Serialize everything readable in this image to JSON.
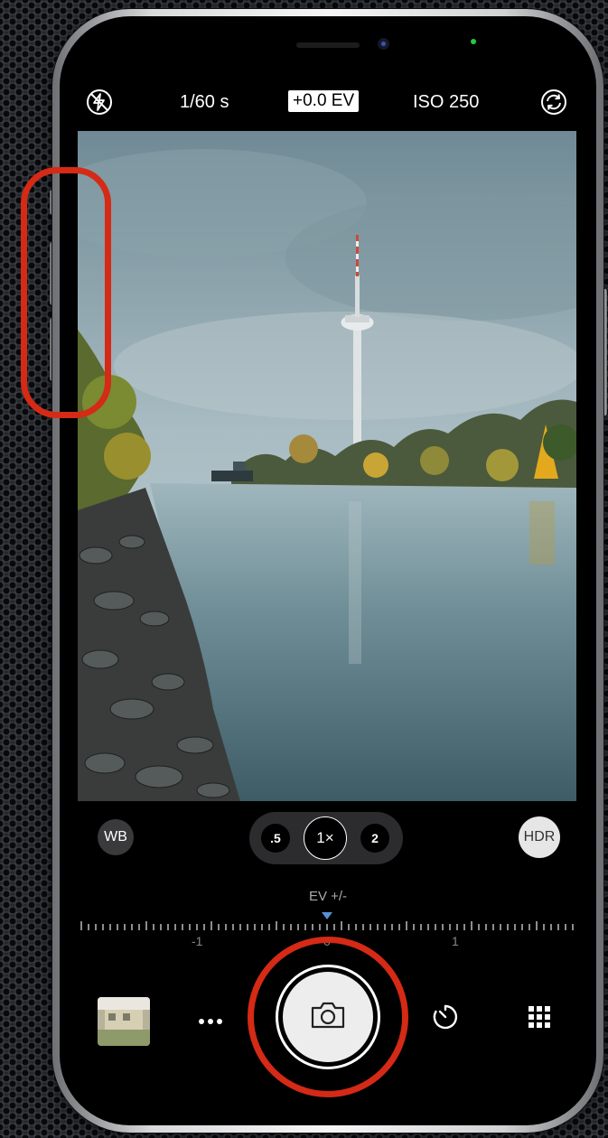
{
  "top_bar": {
    "flash_icon": "flash-off-icon",
    "shutter_speed": "1/60 s",
    "exposure": "+0.0 EV",
    "iso": "ISO 250",
    "switch_camera_icon": "camera-switch-icon"
  },
  "controls": {
    "white_balance": "WB",
    "zoom_options": [
      ".5",
      "1×",
      "2"
    ],
    "zoom_selected": "1×",
    "hdr": "HDR"
  },
  "exposure_ruler": {
    "label": "EV +/-",
    "ticks": [
      "-1",
      "0",
      "1"
    ],
    "value": 0
  },
  "bottom_bar": {
    "more_icon": "more-dots-icon",
    "shutter_icon": "camera-icon",
    "timer_icon": "timer-icon",
    "grid_icon": "grid-icon"
  },
  "colors": {
    "annotation": "#d42a16",
    "hdr_active": "#e6e6e6",
    "ruler_marker": "#5a8fd6"
  }
}
